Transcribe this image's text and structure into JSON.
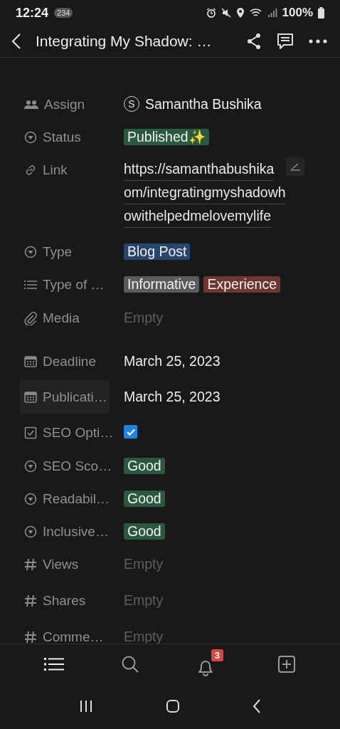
{
  "status_bar": {
    "time": "12:24",
    "badge": "234",
    "battery": "100%"
  },
  "header": {
    "title": "Integrating My Shadow: …"
  },
  "properties": [
    {
      "kind": "person",
      "label": "Assign",
      "highlighted": false,
      "avatar": "S",
      "value": "Samantha Bushika"
    },
    {
      "kind": "select",
      "label": "Status",
      "highlighted": false,
      "tags": [
        {
          "text": "Published✨",
          "color": "#2b593f"
        }
      ]
    },
    {
      "kind": "url",
      "label": "Link",
      "highlighted": false,
      "lines": [
        "https://samanthabushika",
        "om/integratingmyshadowh",
        "owithelpedmelovemylife"
      ]
    },
    {
      "kind": "select",
      "label": "Type",
      "highlighted": false,
      "tags": [
        {
          "text": "Blog Post",
          "color": "#28456c"
        }
      ]
    },
    {
      "kind": "multi_select",
      "label": "Type of …",
      "highlighted": false,
      "tags": [
        {
          "text": "Informative",
          "color": "#5a5a5a"
        },
        {
          "text": "Experience",
          "color": "#6e3630"
        }
      ]
    },
    {
      "kind": "files",
      "label": "Media",
      "highlighted": false,
      "value": "Empty"
    },
    {
      "kind": "date",
      "label": "Deadline",
      "highlighted": false,
      "value": "March 25, 2023"
    },
    {
      "kind": "date",
      "label": "Publicati…",
      "highlighted": true,
      "value": "March 25, 2023"
    },
    {
      "kind": "checkbox",
      "label": "SEO Opti…",
      "highlighted": false,
      "checked": true
    },
    {
      "kind": "select",
      "label": "SEO Sco…",
      "highlighted": false,
      "tags": [
        {
          "text": "Good",
          "color": "#2b593f"
        }
      ]
    },
    {
      "kind": "select",
      "label": "Readabil…",
      "highlighted": false,
      "tags": [
        {
          "text": "Good",
          "color": "#2b593f"
        }
      ]
    },
    {
      "kind": "select",
      "label": "Inclusive…",
      "highlighted": false,
      "tags": [
        {
          "text": "Good",
          "color": "#2b593f"
        }
      ]
    },
    {
      "kind": "number",
      "label": "Views",
      "highlighted": false,
      "value": "Empty"
    },
    {
      "kind": "number",
      "label": "Shares",
      "highlighted": false,
      "value": "Empty"
    },
    {
      "kind": "number",
      "label": "Comme…",
      "highlighted": false,
      "value": "Empty"
    }
  ],
  "tab_bar": {
    "notification_count": "3"
  }
}
